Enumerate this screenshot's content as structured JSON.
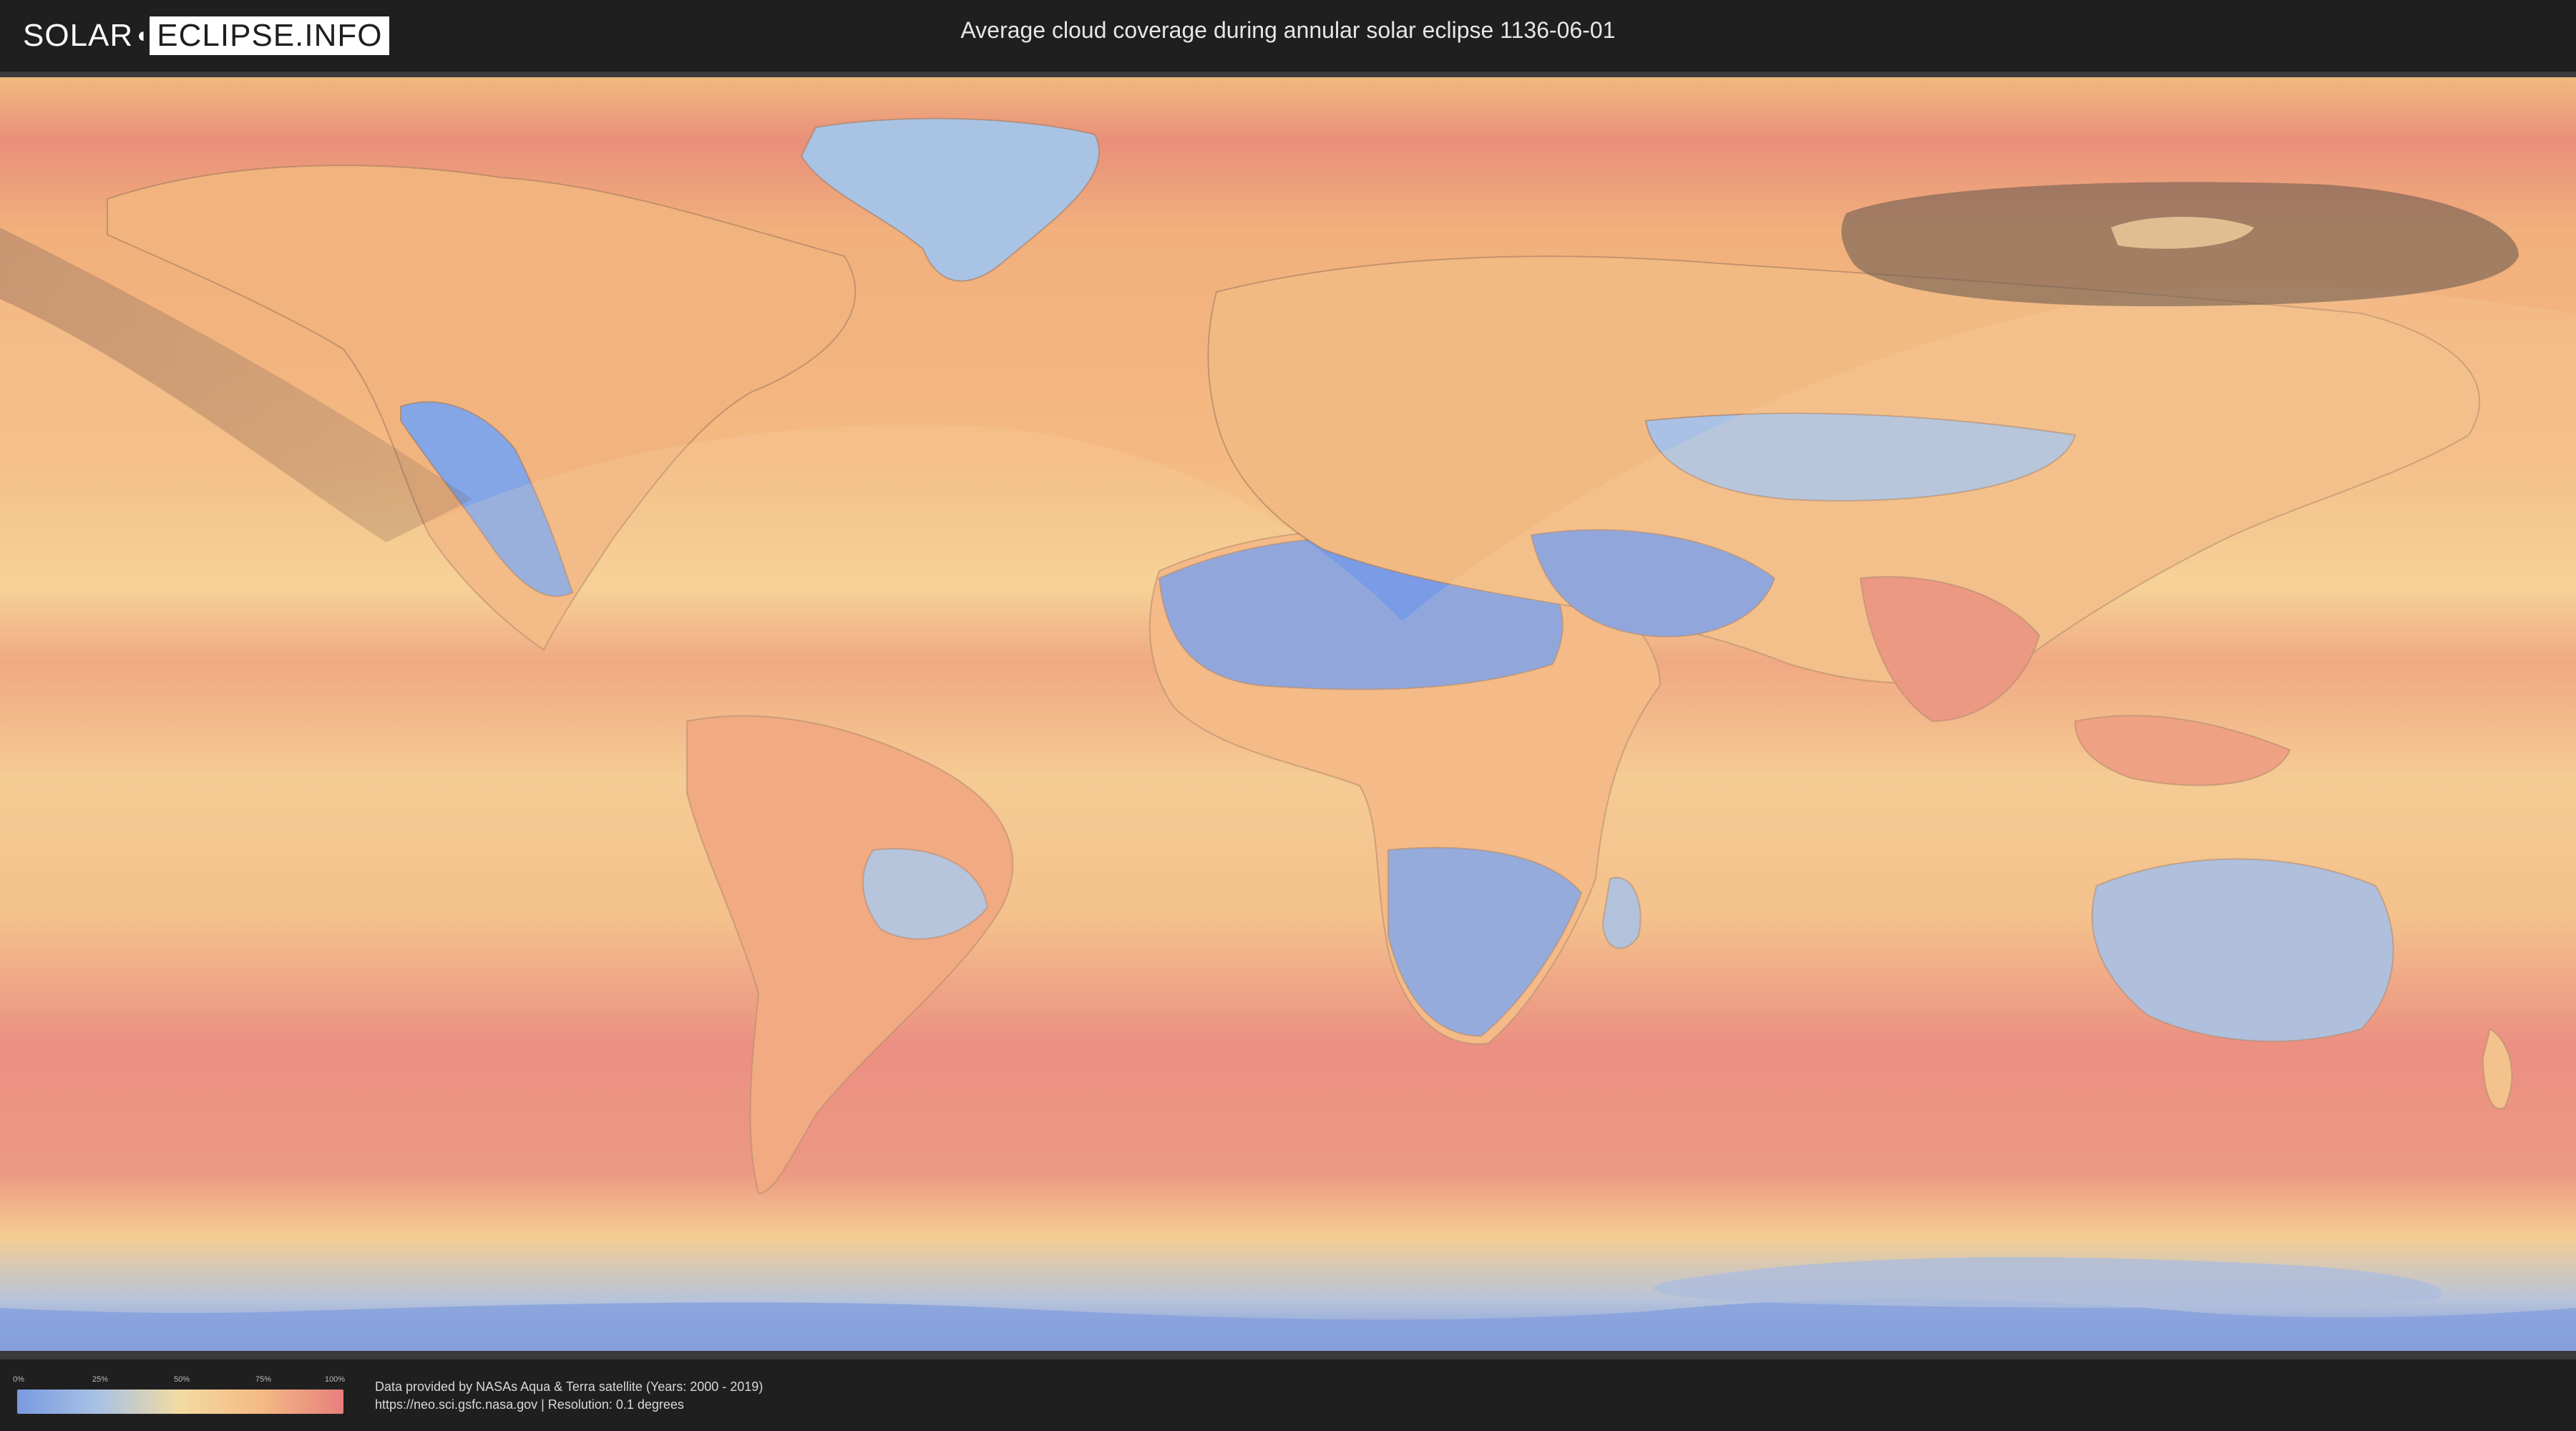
{
  "header": {
    "logo_left": "SOLAR",
    "logo_right": "ECLIPSE.INFO",
    "title": "Average cloud coverage during annular solar eclipse 1136-06-01"
  },
  "map": {
    "description_layer": "cloud coverage",
    "colors": {
      "clear": "#6f94e8",
      "partly": "#b7c9e3",
      "mid": "#f6d08c",
      "cloudy": "#f3b07a",
      "overcast": "#e77d7a",
      "path": "#7a6a60"
    }
  },
  "legend": {
    "ticks": [
      "0%",
      "25%",
      "50%",
      "75%",
      "100%"
    ],
    "gradient": [
      "#7a9ae0",
      "#a9c2e4",
      "#f3dba2",
      "#f4b984",
      "#e77f7d"
    ]
  },
  "footer": {
    "line1": "Data provided by NASAs Aqua & Terra satellite (Years: 2000 - 2019)",
    "line2": "https://neo.sci.gsfc.nasa.gov | Resolution: 0.1 degrees"
  }
}
